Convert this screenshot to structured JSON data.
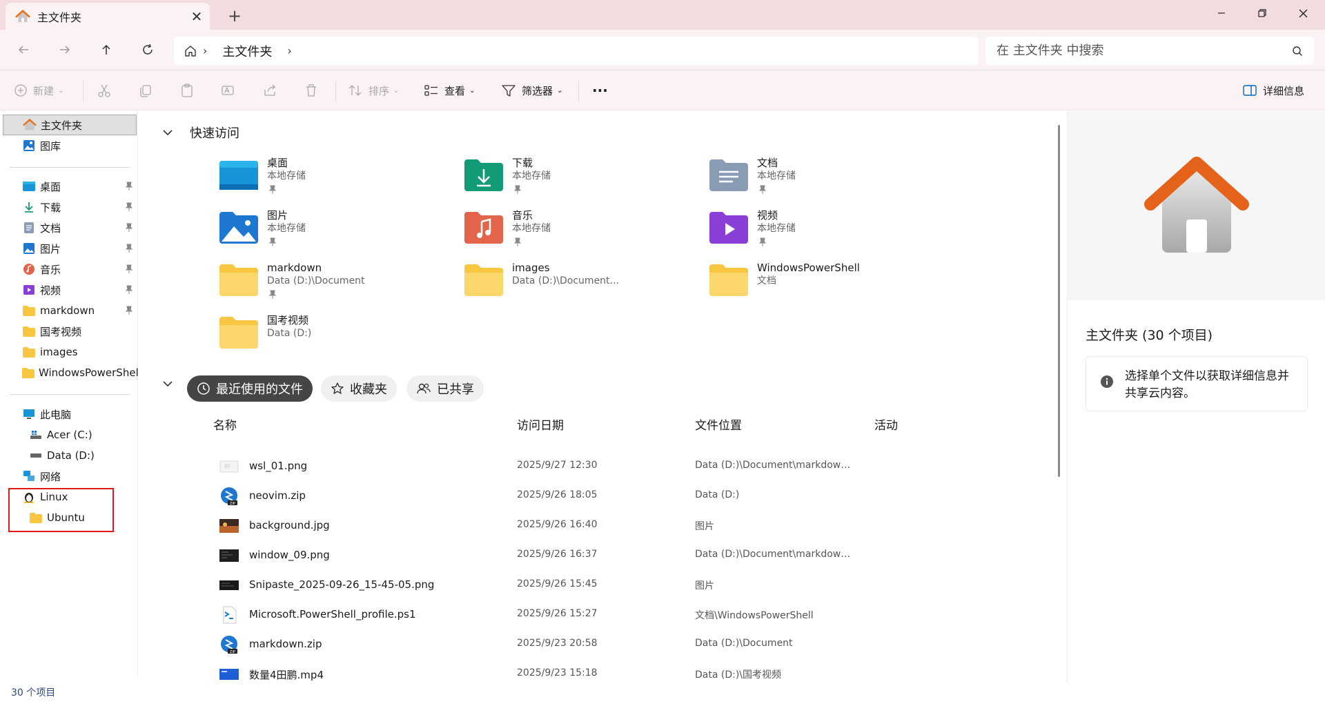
{
  "window": {
    "tab_title": "主文件夹",
    "new_tab_label": "+",
    "minimize_label": "—",
    "maximize_label": "❐",
    "close_label": "✕"
  },
  "navbar": {
    "breadcrumb": [
      "主文件夹"
    ],
    "search_placeholder": "在 主文件夹 中搜索"
  },
  "commandbar": {
    "new_label": "新建",
    "sort_label": "排序",
    "view_label": "查看",
    "filter_label": "筛选器",
    "more_label": "···",
    "details_label": "详细信息"
  },
  "sidebar": {
    "home": "主文件夹",
    "gallery": "图库",
    "pinned": [
      {
        "label": "桌面",
        "icon": "desktop-icon",
        "pinned": true
      },
      {
        "label": "下载",
        "icon": "download-icon",
        "pinned": true
      },
      {
        "label": "文档",
        "icon": "document-icon",
        "pinned": true
      },
      {
        "label": "图片",
        "icon": "pictures-icon",
        "pinned": true
      },
      {
        "label": "音乐",
        "icon": "music-icon",
        "pinned": true
      },
      {
        "label": "视频",
        "icon": "video-icon",
        "pinned": true
      },
      {
        "label": "markdown",
        "icon": "folder-icon",
        "pinned": true
      },
      {
        "label": "国考视频",
        "icon": "folder-icon",
        "pinned": false
      },
      {
        "label": "images",
        "icon": "folder-icon",
        "pinned": false
      },
      {
        "label": "WindowsPowerShell",
        "icon": "folder-icon",
        "pinned": false
      }
    ],
    "this_pc": "此电脑",
    "drives": [
      "Acer (C:)",
      "Data (D:)"
    ],
    "network": "网络",
    "linux": "Linux",
    "ubuntu": "Ubuntu"
  },
  "quick_access": {
    "title": "快速访问",
    "items": [
      {
        "name": "桌面",
        "sub": "本地存储",
        "pinned": true,
        "icon": "desktop-folder-icon"
      },
      {
        "name": "下载",
        "sub": "本地存储",
        "pinned": true,
        "icon": "download-folder-icon"
      },
      {
        "name": "文档",
        "sub": "本地存储",
        "pinned": true,
        "icon": "documents-folder-icon"
      },
      {
        "name": "图片",
        "sub": "本地存储",
        "pinned": true,
        "icon": "pictures-folder-icon"
      },
      {
        "name": "音乐",
        "sub": "本地存储",
        "pinned": true,
        "icon": "music-folder-icon"
      },
      {
        "name": "视频",
        "sub": "本地存储",
        "pinned": true,
        "icon": "videos-folder-icon"
      },
      {
        "name": "markdown",
        "sub": "Data (D:)\\Document",
        "pinned": true,
        "icon": "folder-icon"
      },
      {
        "name": "images",
        "sub": "Data (D:)\\Document...",
        "pinned": false,
        "icon": "folder-icon"
      },
      {
        "name": "WindowsPowerShell",
        "sub": "文档",
        "pinned": false,
        "icon": "folder-icon"
      },
      {
        "name": "国考视频",
        "sub": "Data (D:)",
        "pinned": false,
        "icon": "folder-icon"
      }
    ]
  },
  "recent": {
    "tabs": [
      "最近使用的文件",
      "收藏夹",
      "已共享"
    ],
    "columns": [
      "名称",
      "访问日期",
      "文件位置",
      "活动"
    ],
    "rows": [
      {
        "name": "wsl_01.png",
        "date": "2025/9/27 12:30",
        "location": "Data (D:)\\Document\\markdown\\...",
        "icon": "image-thumb-icon"
      },
      {
        "name": "neovim.zip",
        "date": "2025/9/26 18:05",
        "location": "Data (D:)",
        "icon": "zip-icon"
      },
      {
        "name": "background.jpg",
        "date": "2025/9/26 16:40",
        "location": "图片",
        "icon": "photo-thumb-icon"
      },
      {
        "name": "window_09.png",
        "date": "2025/9/26 16:37",
        "location": "Data (D:)\\Document\\markdown\\...",
        "icon": "dark-thumb-icon"
      },
      {
        "name": "Snipaste_2025-09-26_15-45-05.png",
        "date": "2025/9/26 15:45",
        "location": "图片",
        "icon": "dark-thumb-icon"
      },
      {
        "name": "Microsoft.PowerShell_profile.ps1",
        "date": "2025/9/26 15:27",
        "location": "文档\\WindowsPowerShell",
        "icon": "script-icon"
      },
      {
        "name": "markdown.zip",
        "date": "2025/9/23 20:58",
        "location": "Data (D:)\\Document",
        "icon": "zip-icon"
      },
      {
        "name": "数量4田鹏.mp4",
        "date": "2025/9/23 15:18",
        "location": "Data (D:)\\国考视频",
        "icon": "video-thumb-icon"
      }
    ]
  },
  "details": {
    "title": "主文件夹 (30 个项目)",
    "info": "选择单个文件以获取详细信息并共享云内容。"
  },
  "status": {
    "count": "30 个项目"
  },
  "colors": {
    "title_bar": "#f3dcdf",
    "chrome": "#fbf2f3",
    "highlight_box": "#e01919",
    "folder_yellow": "#f8c640",
    "pill_active": "#454545"
  }
}
